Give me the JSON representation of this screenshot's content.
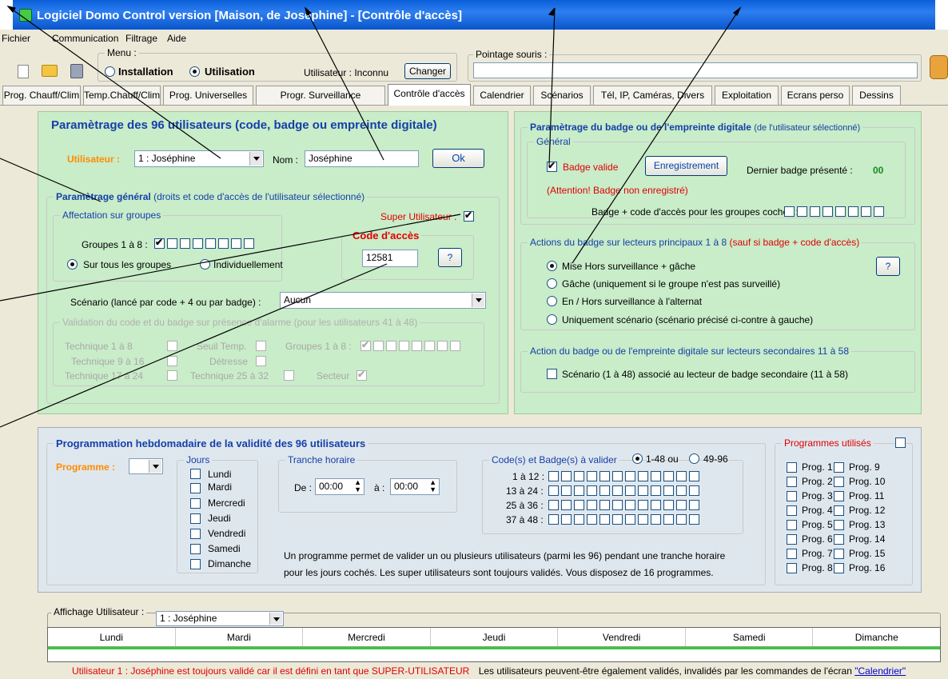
{
  "window": {
    "title": "Logiciel Domo Control version  [Maison, de Joséphine] - [Contrôle d'accès]"
  },
  "menu": [
    "Fichier",
    "Communication",
    "Filtrage",
    "Aide"
  ],
  "toolbar": {
    "menu_label": "Menu :",
    "mode_installation": "Installation",
    "mode_utilisation": "Utilisation",
    "user_label": "Utilisateur : Inconnu",
    "change_button": "Changer",
    "pointage_label": "Pointage souris :"
  },
  "tabs": [
    "Prog. Chauff/Clim",
    "Temp.Chauff/Clim",
    "Prog. Universelles",
    "Progr. Surveillance",
    "Contrôle d'accès",
    "Calendrier",
    "Scénarios",
    "Tél, IP, Caméras, Divers",
    "Exploitation",
    "Ecrans perso",
    "Dessins"
  ],
  "users_panel": {
    "title": "Paramètrage des 96 utilisateurs (code, badge ou empreinte digitale)",
    "user_label": "Utilisateur :",
    "user_value": "1 : Joséphine",
    "name_label": "Nom :",
    "name_value": "Joséphine",
    "ok_button": "Ok",
    "general_title": "Paramètrage général",
    "general_subtitle": "(droits et code d'accès de l'utilisateur sélectionné)",
    "groups_title": "Affectation sur groupes",
    "groups_label": "Groupes 1 à 8 :",
    "radio_all": "Sur tous les groupes",
    "radio_individual": "Individuellement",
    "super_user": "Super Utilisateur :",
    "code_title": "Code d'accès",
    "code_value": "12581",
    "help": "?",
    "scenario_label": "Scénario (lancé par code + 4 ou par badge) :",
    "scenario_value": "Aucun",
    "validation_title": "Validation du code et du badge sur présence d'alarme",
    "validation_sub": "(pour les utilisateurs 41 à 48)",
    "tech18": "Technique 1 à 8",
    "seuil": "Seuil Temp.",
    "groupes18": "Groupes 1 à 8 :",
    "tech916": "Technique 9 à 16",
    "detresse": "Détresse",
    "tech1724": "Technique 17 à 24",
    "tech2532": "Technique 25 à 32",
    "secteur": "Secteur"
  },
  "badge_panel": {
    "title": "Paramètrage du badge ou de l'empreinte digitale",
    "subtitle": "(de l'utilisateur sélectionné)",
    "general": "Général",
    "badge_valid": "Badge valide",
    "register_button": "Enregistrement",
    "last_badge_label": "Dernier badge présenté :",
    "last_badge_value": "00",
    "warning": "(Attention! Badge non enregistré)",
    "badge_code_label": "Badge + code d'accès pour les groupes cochés :",
    "actions_title": "Actions du badge sur lecteurs principaux 1 à 8",
    "actions_sub": "(sauf si badge + code d'accès)",
    "action1": "Mise Hors surveillance + gâche",
    "action2": "Gâche (uniquement si le groupe n'est pas surveillé)",
    "action3": "En / Hors surveillance à l'alternat",
    "action4": "Uniquement scénario (scénario précisé ci-contre à gauche)",
    "secondary_title": "Action du badge ou de l'empreinte digitale sur lecteurs secondaires 11 à 58",
    "secondary_label": "Scénario (1 à 48) associé au lecteur de badge secondaire (11 à 58)",
    "help": "?"
  },
  "weekly_panel": {
    "title": "Programmation hebdomadaire de la validité des 96 utilisateurs",
    "program_label": "Programme :",
    "days_title": "Jours",
    "days": [
      "Lundi",
      "Mardi",
      "Mercredi",
      "Jeudi",
      "Vendredi",
      "Samedi",
      "Dimanche"
    ],
    "time_title": "Tranche horaire",
    "from_label": "De :",
    "from_value": "00:00",
    "to_label": "à :",
    "to_value": "00:00",
    "codes_title": "Code(s) et Badge(s) à valider",
    "range1": "1-48 ou",
    "range2": "49-96",
    "rows": [
      "1 à 12 :",
      "13 à 24 :",
      "25 à 36 :",
      "37 à 48 :"
    ],
    "info1": "Un programme permet de valider un ou plusieurs utilisateurs (parmi les 96) pendant une tranche horaire",
    "info2": "pour les jours cochés. Les super utilisateurs sont toujours validés. Vous disposez de 16 programmes.",
    "programs_title": "Programmes utilisés",
    "programs": [
      "Prog. 1",
      "Prog. 2",
      "Prog. 3",
      "Prog. 4",
      "Prog. 5",
      "Prog. 6",
      "Prog. 7",
      "Prog. 8",
      "Prog. 9",
      "Prog. 10",
      "Prog. 11",
      "Prog. 12",
      "Prog. 13",
      "Prog. 14",
      "Prog. 15",
      "Prog. 16"
    ]
  },
  "display_panel": {
    "label": "Affichage Utilisateur :",
    "value": "1 : Joséphine",
    "days": [
      "Lundi",
      "Mardi",
      "Mercredi",
      "Jeudi",
      "Vendredi",
      "Samedi",
      "Dimanche"
    ]
  },
  "status": {
    "message1": "Utilisateur 1 : Joséphine est toujours validé car il est défini en tant que SUPER-UTILISATEUR",
    "message2": "Les utilisateurs peuvent-être également validés, invalidés par les commandes de l'écran",
    "link": "\"Calendrier\""
  },
  "colors": {
    "green_panel": "#c9ecc9",
    "grey_panel": "#dfe7ee",
    "title_blue": "#1540a8",
    "accent_orange": "#ff8c00",
    "alert_red": "#e00000",
    "validity_green": "#33cc33"
  }
}
